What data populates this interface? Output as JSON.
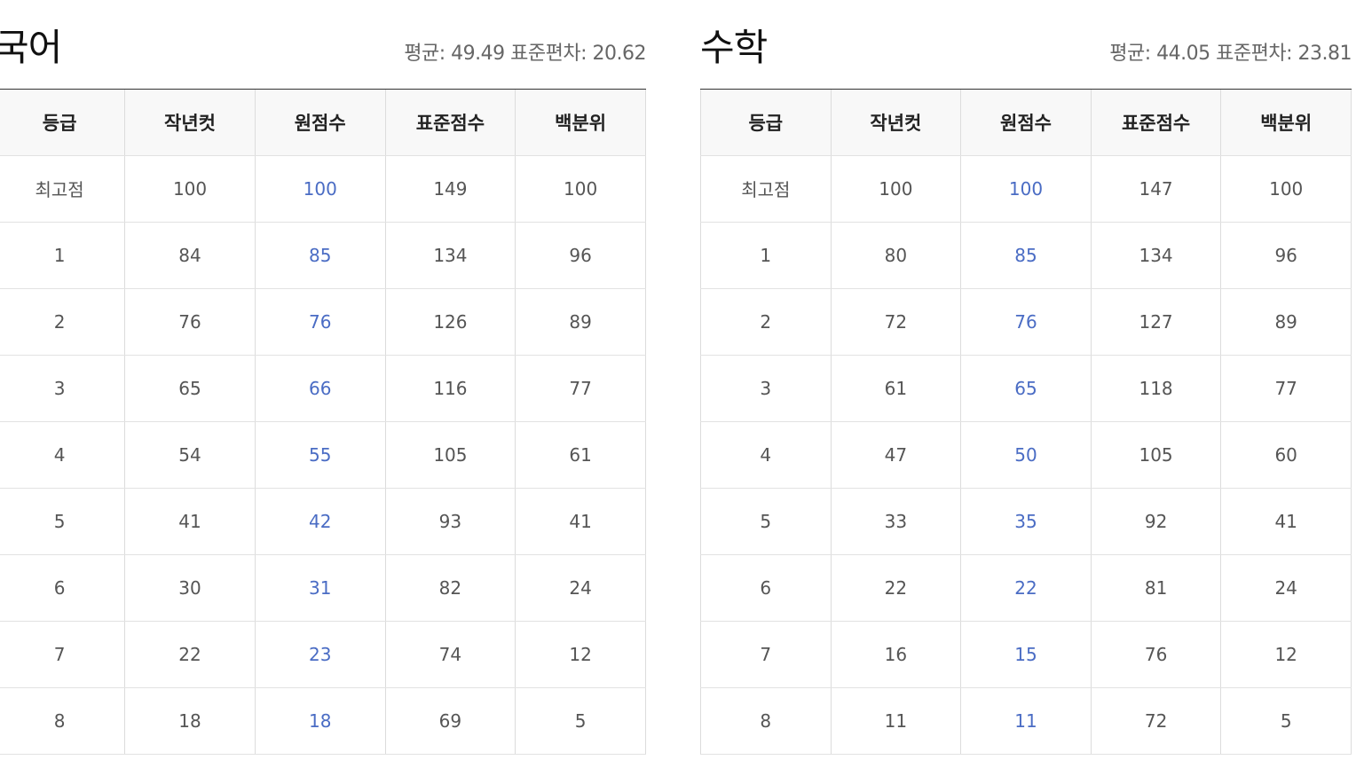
{
  "columns": [
    "등급",
    "작년컷",
    "원점수",
    "표준점수",
    "백분위"
  ],
  "subjects": [
    {
      "title": "국어",
      "stats": "평균: 49.49 표준편차: 20.62",
      "rows": [
        [
          "최고점",
          "100",
          "100",
          "149",
          "100"
        ],
        [
          "1",
          "84",
          "85",
          "134",
          "96"
        ],
        [
          "2",
          "76",
          "76",
          "126",
          "89"
        ],
        [
          "3",
          "65",
          "66",
          "116",
          "77"
        ],
        [
          "4",
          "54",
          "55",
          "105",
          "61"
        ],
        [
          "5",
          "41",
          "42",
          "93",
          "41"
        ],
        [
          "6",
          "30",
          "31",
          "82",
          "24"
        ],
        [
          "7",
          "22",
          "23",
          "74",
          "12"
        ],
        [
          "8",
          "18",
          "18",
          "69",
          "5"
        ]
      ]
    },
    {
      "title": "수학",
      "stats": "평균: 44.05 표준편차: 23.81",
      "rows": [
        [
          "최고점",
          "100",
          "100",
          "147",
          "100"
        ],
        [
          "1",
          "80",
          "85",
          "134",
          "96"
        ],
        [
          "2",
          "72",
          "76",
          "127",
          "89"
        ],
        [
          "3",
          "61",
          "65",
          "118",
          "77"
        ],
        [
          "4",
          "47",
          "50",
          "105",
          "60"
        ],
        [
          "5",
          "33",
          "35",
          "92",
          "41"
        ],
        [
          "6",
          "22",
          "22",
          "81",
          "24"
        ],
        [
          "7",
          "16",
          "15",
          "76",
          "12"
        ],
        [
          "8",
          "11",
          "11",
          "72",
          "5"
        ]
      ]
    }
  ],
  "colors": {
    "raw_score_text": "#4a6cc4",
    "header_bg": "#f8f8f8",
    "title_text": "#111111"
  }
}
